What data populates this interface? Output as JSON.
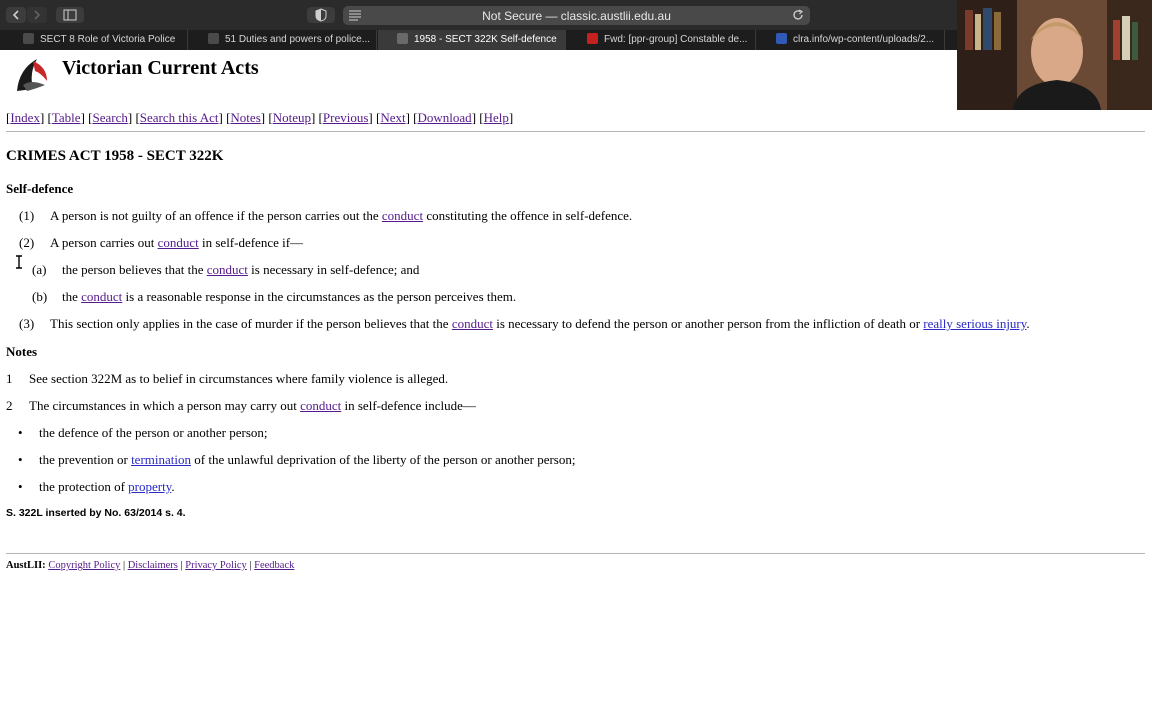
{
  "browser": {
    "address": "Not Secure — classic.austlii.edu.au",
    "tabs": [
      {
        "label": "SECT 8 Role of Victoria Police",
        "color": "#3c3c3c"
      },
      {
        "label": "51 Duties and powers of police...",
        "color": "#3c3c3c"
      },
      {
        "label": "1958 - SECT 322K Self-defence",
        "color": "#3c3c3c",
        "active": true
      },
      {
        "label": "Fwd: [ppr-group] Constable de...",
        "color": "#c5221f"
      },
      {
        "label": "clra.info/wp-content/uploads/2...",
        "color": "#2f5bb7"
      }
    ]
  },
  "site": {
    "title": "Victorian Current Acts",
    "nav": [
      "Index",
      "Table",
      "Search",
      "Search this Act",
      "Notes",
      "Noteup",
      "Previous",
      "Next",
      "Download",
      "Help"
    ]
  },
  "act": {
    "heading": "CRIMES ACT 1958 - SECT 322K",
    "subheading": "Self-defence",
    "p1": {
      "num": "(1)",
      "pre": "A person is not guilty of an offence if the person carries out the ",
      "link": "conduct",
      "post": " constituting the offence in self-defence."
    },
    "p2": {
      "num": "(2)",
      "pre": "A person carries out ",
      "link": "conduct",
      "post": " in self-defence if—"
    },
    "pa": {
      "num": "(a)",
      "pre": "the person believes that the ",
      "link": "conduct",
      "post": " is necessary in self-defence; and"
    },
    "pb": {
      "num": "(b)",
      "pre": "the ",
      "link": "conduct",
      "post": " is a reasonable response in the circumstances as the person perceives them."
    },
    "p3": {
      "num": "(3)",
      "pre": "This section only applies in the case of murder if the person believes that the ",
      "link": "conduct",
      "mid": " is necessary to defend the person or another person from the infliction of death or ",
      "link2": "really serious injury",
      "post": "."
    }
  },
  "notes": {
    "heading": "Notes",
    "n1": {
      "num": "1",
      "text": "See section 322M as to belief in circumstances where family violence is alleged."
    },
    "n2": {
      "num": "2",
      "pre": "The circumstances in which a person may carry out ",
      "link": "conduct",
      "post": " in self-defence include—"
    },
    "b1": {
      "text": "the defence of the person or another person;"
    },
    "b2": {
      "pre": "the prevention or ",
      "link": "termination",
      "post": " of the unlawful deprivation of the liberty of the person or another person;"
    },
    "b3": {
      "pre": "the protection of ",
      "link": "property",
      "post": "."
    },
    "bullet": "•"
  },
  "footnote": "S. 322L inserted by No. 63/2014 s. 4.",
  "footer": {
    "brand": "AustLII:",
    "links": [
      "Copyright Policy",
      "Disclaimers",
      "Privacy Policy",
      "Feedback"
    ],
    "sep": " | "
  }
}
